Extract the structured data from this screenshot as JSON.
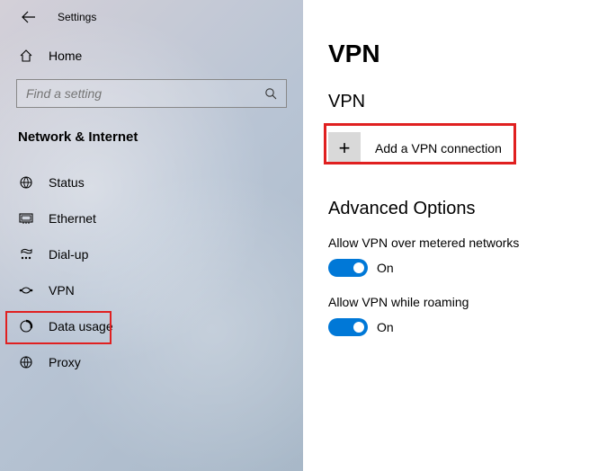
{
  "app_title": "Settings",
  "home_label": "Home",
  "search": {
    "placeholder": "Find a setting"
  },
  "category_header": "Network & Internet",
  "nav_items": [
    {
      "label": "Status"
    },
    {
      "label": "Ethernet"
    },
    {
      "label": "Dial-up"
    },
    {
      "label": "VPN"
    },
    {
      "label": "Data usage"
    },
    {
      "label": "Proxy"
    }
  ],
  "page": {
    "title": "VPN",
    "section_heading": "VPN",
    "add_label": "Add a VPN connection",
    "advanced_heading": "Advanced Options",
    "options": [
      {
        "label": "Allow VPN over metered networks",
        "state": "On"
      },
      {
        "label": "Allow VPN while roaming",
        "state": "On"
      }
    ]
  }
}
